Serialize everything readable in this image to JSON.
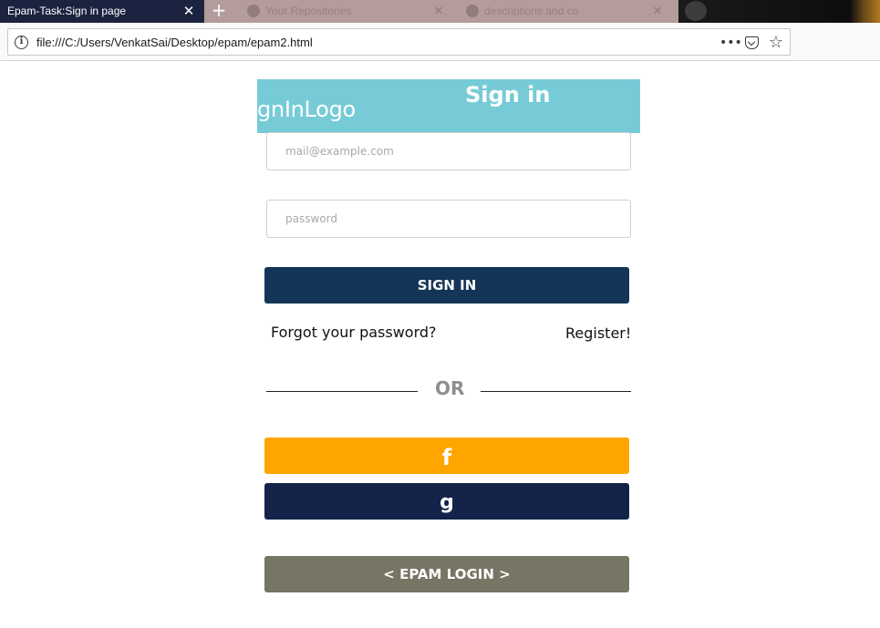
{
  "browser": {
    "active_tab": {
      "title": "Epam-Task:Sign in page"
    },
    "inactive_tabs": [
      {
        "title": "Your Repositories"
      },
      {
        "title": "descriptions and co"
      }
    ],
    "url": "file:///C:/Users/VenkatSai/Desktop/epam/epam2.html",
    "actions": {
      "more": "•••",
      "star": "☆"
    }
  },
  "page": {
    "logo_text": "gnInLogo",
    "heading": "Sign in",
    "email": {
      "placeholder": "mail@example.com",
      "value": ""
    },
    "password": {
      "placeholder": "password",
      "value": ""
    },
    "signin_button": "SIGN IN",
    "forgot_link": "Forgot your password?",
    "register_link": "Register!",
    "divider_text": "OR",
    "facebook_button": "f",
    "google_button": "g",
    "epam_button": "< EPAM LOGIN >"
  },
  "colors": {
    "header_band": "#76cbd6",
    "signin_button": "#143558",
    "facebook_button": "#ffa500",
    "google_button": "#13234a",
    "epam_button": "#777563"
  }
}
